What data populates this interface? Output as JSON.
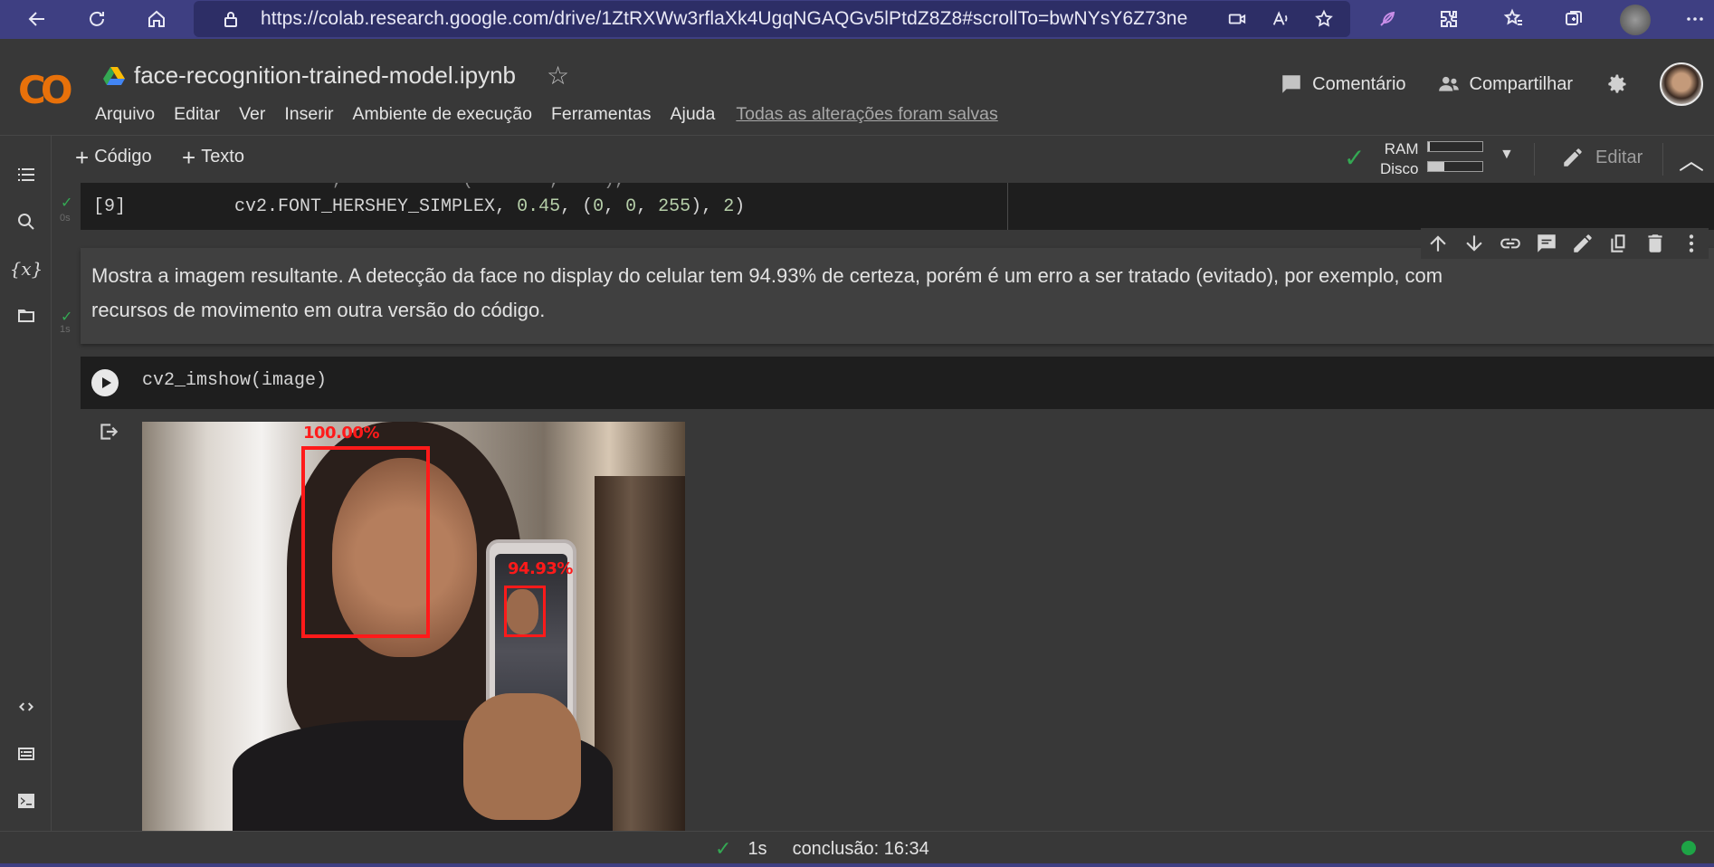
{
  "browser": {
    "url": "https://colab.research.google.com/drive/1ZtRXWw3rflaXk4UgqNGAQGv5lPtdZ8Z8#scrollTo=bwNYsY6Z73ne"
  },
  "header": {
    "logo": "CO",
    "notebook_name": "face-recognition-trained-model.ipynb",
    "menu": [
      "Arquivo",
      "Editar",
      "Ver",
      "Inserir",
      "Ambiente de execução",
      "Ferramentas",
      "Ajuda"
    ],
    "saved_status": "Todas as alterações foram salvas",
    "comment_label": "Comentário",
    "share_label": "Compartilhar"
  },
  "toolbar": {
    "add_code": "Código",
    "add_text": "Texto",
    "ram_label": "RAM",
    "disk_label": "Disco",
    "ram_usage": 0.04,
    "disk_usage": 0.3,
    "edit_label": "Editar"
  },
  "cells": {
    "code1": {
      "exec_count": "[9]",
      "time": "0s",
      "line_prefix": "cv2.FONT_HERSHEY_SIMPLEX, ",
      "num1": "0.45",
      "mid": ", (",
      "num2": "0",
      "sep1": ", ",
      "num3": "0",
      "sep2": ", ",
      "num4": "255",
      "mid2": "), ",
      "num5": "2",
      "end": ")"
    },
    "text": {
      "content": "Mostra a imagem resultante. A detecção da face no display do celular tem 94.93% de certeza, porém é um erro a ser tratado (evitado), por exemplo, com recursos de movimento em outra versão do código."
    },
    "code2": {
      "time": "1s",
      "code": "cv2_imshow(image)"
    },
    "output": {
      "label_main": "100.00%",
      "label_phone": "94.93%"
    }
  },
  "statusbar": {
    "duration": "1s",
    "completion": "conclusão: 16:34"
  }
}
